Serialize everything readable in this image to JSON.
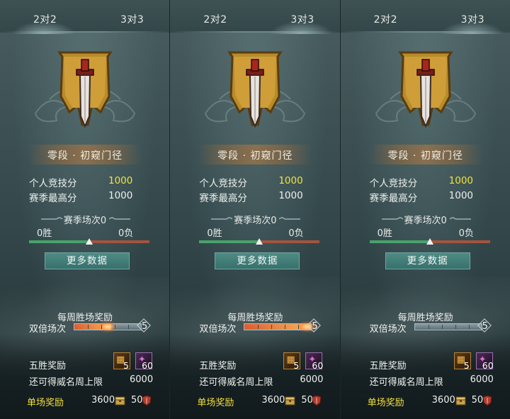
{
  "tabs": [
    "2对2",
    "3对3"
  ],
  "panels": [
    {
      "rank_name": "零段 · 初窥门径",
      "personal_score_label": "个人竞技分",
      "personal_score_value": "1000",
      "season_high_label": "赛季最高分",
      "season_high_value": "1000",
      "season_matches": "赛季场次0",
      "wins": "0胜",
      "losses": "0负",
      "more_data_button": "更多数据",
      "weekly_reward_title": "每周胜场奖励",
      "double_label": "双倍场次",
      "double_count": "5",
      "double_progress": 0.55,
      "five_win_label": "五胜奖励",
      "reward_item1_count": "5",
      "reward_item2_count": "60",
      "weekly_limit_label": "还可得威名周上限",
      "weekly_limit_value": "6000",
      "single_reward_label": "单场奖励",
      "single_reward_a": "3600",
      "single_reward_b": "50"
    },
    {
      "rank_name": "零段 · 初窥门径",
      "personal_score_label": "个人竞技分",
      "personal_score_value": "1000",
      "season_high_label": "赛季最高分",
      "season_high_value": "1000",
      "season_matches": "赛季场次0",
      "wins": "0胜",
      "losses": "0负",
      "more_data_button": "更多数据",
      "weekly_reward_title": "每周胜场奖励",
      "double_label": "双倍场次",
      "double_count": "5",
      "double_progress": 1.0,
      "five_win_label": "五胜奖励",
      "reward_item1_count": "5",
      "reward_item2_count": "60",
      "weekly_limit_label": "还可得威名周上限",
      "weekly_limit_value": "6000",
      "single_reward_label": "单场奖励",
      "single_reward_a": "3600",
      "single_reward_b": "50"
    },
    {
      "rank_name": "零段 · 初窥门径",
      "personal_score_label": "个人竞技分",
      "personal_score_value": "1000",
      "season_high_label": "赛季最高分",
      "season_high_value": "1000",
      "season_matches": "赛季场次0",
      "wins": "0胜",
      "losses": "0负",
      "more_data_button": "更多数据",
      "weekly_reward_title": "每周胜场奖励",
      "double_label": "双倍场次",
      "double_count": "5",
      "double_progress": 0.0,
      "five_win_label": "五胜奖励",
      "reward_item1_count": "5",
      "reward_item2_count": "60",
      "weekly_limit_label": "还可得威名周上限",
      "weekly_limit_value": "6000",
      "single_reward_label": "单场奖励",
      "single_reward_a": "3600",
      "single_reward_b": "50"
    }
  ],
  "active_tab_per_panel": [
    0,
    1,
    1
  ],
  "colors": {
    "highlight_yellow": "#f1e33b",
    "win_green": "#49a36b",
    "loss_red": "#a4543f",
    "button_teal": "#3f7c78"
  },
  "icons": [
    "sword-banner-emblem-icon",
    "reward-chest-icon",
    "reward-potion-icon",
    "coin-chest-icon",
    "shield-badge-icon"
  ]
}
